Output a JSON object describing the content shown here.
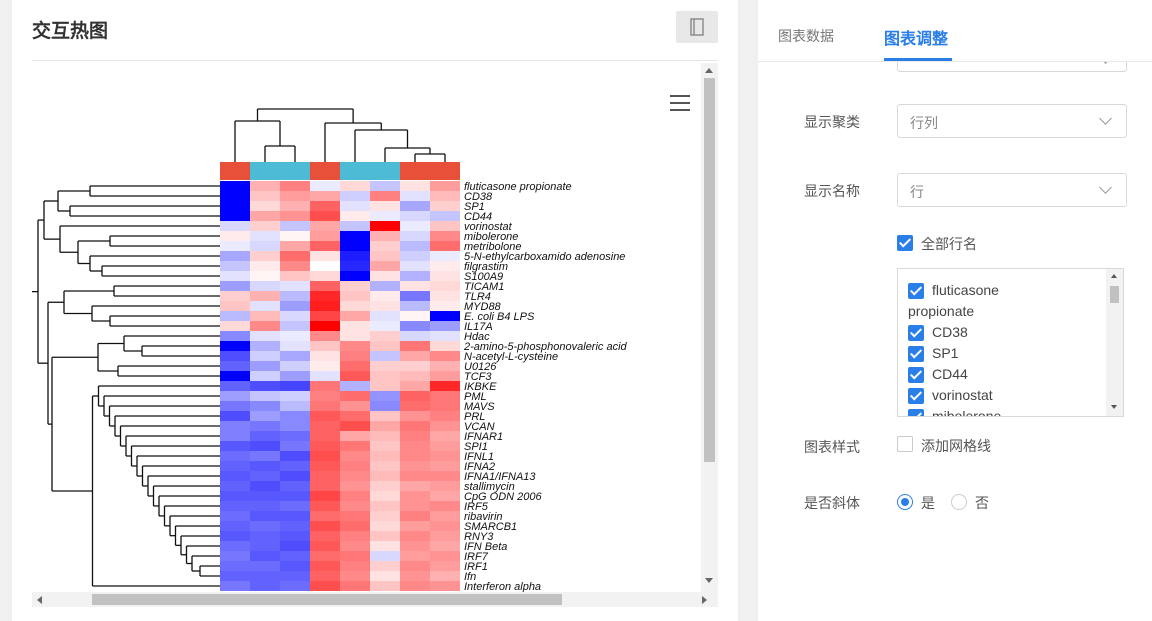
{
  "panel": {
    "title": "交互热图",
    "toolbar_icon": "document-icon",
    "menu_icon": "hamburger-menu-icon"
  },
  "chart_data": {
    "type": "heatmap",
    "columns": 8,
    "column_groups": [
      "red",
      "cyan",
      "cyan",
      "red",
      "cyan",
      "cyan",
      "red",
      "red"
    ],
    "rows": [
      "fluticasone propionate",
      "CD38",
      "SP1",
      "CD44",
      "vorinostat",
      "mibolerone",
      "metribolone",
      "5-N-ethylcarboxamido adenosine",
      "filgrastim",
      "S100A9",
      "TICAM1",
      "TLR4",
      "MYD88",
      "E. coli B4 LPS",
      "IL17A",
      "Hdac",
      "2-amino-5-phosphonovaleric acid",
      "N-acetyl-L-cysteine",
      "U0126",
      "TCF3",
      "IKBKE",
      "PML",
      "MAVS",
      "PRL",
      "VCAN",
      "IFNAR1",
      "SPI1",
      "IFNL1",
      "IFNA2",
      "IFNA1/IFNA13",
      "stallimycin",
      "CpG ODN 2006",
      "IRF5",
      "ribavirin",
      "SMARCB1",
      "RNY3",
      "IFN Beta",
      "IRF7",
      "IRF1",
      "Ifn",
      "Interferon alpha"
    ],
    "values": [
      [
        -2.6,
        0.8,
        1.3,
        -0.2,
        0.4,
        -0.6,
        0.3,
        1.0
      ],
      [
        -2.6,
        0.6,
        1.0,
        0.9,
        -0.5,
        1.3,
        -0.3,
        0.7
      ],
      [
        -2.6,
        0.4,
        0.8,
        1.6,
        -0.3,
        0.3,
        -0.9,
        0.5
      ],
      [
        -2.6,
        0.9,
        1.1,
        1.8,
        0.2,
        -0.2,
        -0.4,
        -0.6
      ],
      [
        -0.4,
        0.5,
        -0.6,
        0.9,
        -0.6,
        2.6,
        -0.2,
        0.6
      ],
      [
        0.2,
        -0.3,
        0.1,
        1.0,
        -2.6,
        0.8,
        -0.4,
        1.2
      ],
      [
        -0.2,
        -0.4,
        0.9,
        1.6,
        -2.6,
        0.5,
        -0.7,
        1.5
      ],
      [
        -0.9,
        0.5,
        1.5,
        0.3,
        -2.3,
        0.6,
        -0.5,
        -0.2
      ],
      [
        -0.6,
        0.2,
        1.2,
        0.0,
        -2.2,
        0.9,
        -0.3,
        0.2
      ],
      [
        -0.3,
        0.1,
        0.6,
        0.4,
        -2.6,
        0.3,
        -0.8,
        0.3
      ],
      [
        -1.0,
        -0.4,
        -0.3,
        1.6,
        0.5,
        -0.8,
        0.3,
        0.4
      ],
      [
        0.5,
        0.8,
        -0.7,
        2.2,
        0.6,
        0.2,
        -1.4,
        0.3
      ],
      [
        0.6,
        -0.3,
        -1.0,
        2.3,
        0.4,
        0.3,
        -0.7,
        0.2
      ],
      [
        -0.7,
        0.7,
        -0.4,
        1.9,
        0.9,
        -0.3,
        0.1,
        -2.6
      ],
      [
        0.4,
        1.2,
        -0.6,
        2.6,
        0.3,
        -0.2,
        -1.2,
        -1.0
      ],
      [
        -1.2,
        -0.3,
        -0.2,
        1.2,
        0.3,
        0.5,
        -0.4,
        -0.3
      ],
      [
        -2.6,
        -0.8,
        -0.3,
        0.6,
        1.2,
        0.6,
        1.4,
        0.4
      ],
      [
        -1.8,
        -0.5,
        -0.9,
        0.3,
        1.3,
        -0.6,
        0.9,
        1.2
      ],
      [
        -1.6,
        -1.0,
        -0.5,
        0.2,
        1.5,
        0.5,
        0.5,
        0.8
      ],
      [
        -2.6,
        -0.5,
        -1.0,
        -0.3,
        1.7,
        0.6,
        0.7,
        1.0
      ],
      [
        -1.6,
        -1.8,
        -1.9,
        1.4,
        -0.8,
        0.6,
        0.9,
        2.2
      ],
      [
        -1.0,
        -0.6,
        -0.5,
        1.3,
        1.5,
        -1.1,
        1.6,
        1.4
      ],
      [
        -1.4,
        -1.2,
        -0.7,
        1.4,
        1.1,
        -1.2,
        1.5,
        1.4
      ],
      [
        -1.8,
        -1.0,
        -1.2,
        1.7,
        1.5,
        0.6,
        1.1,
        1.3
      ],
      [
        -1.3,
        -1.4,
        -1.2,
        1.6,
        1.8,
        0.9,
        1.4,
        1.1
      ],
      [
        -1.3,
        -1.6,
        -1.5,
        1.6,
        0.9,
        0.7,
        1.3,
        0.9
      ],
      [
        -1.7,
        -1.8,
        -1.4,
        1.7,
        1.4,
        0.6,
        1.2,
        1.0
      ],
      [
        -1.5,
        -1.4,
        -1.8,
        1.8,
        1.2,
        0.7,
        1.2,
        1.1
      ],
      [
        -1.6,
        -1.7,
        -1.6,
        1.7,
        1.3,
        0.6,
        1.1,
        1.0
      ],
      [
        -1.7,
        -1.6,
        -1.8,
        1.6,
        1.2,
        0.7,
        1.2,
        1.2
      ],
      [
        -1.6,
        -1.8,
        -1.6,
        1.6,
        1.1,
        0.5,
        0.9,
        1.0
      ],
      [
        -1.7,
        -1.7,
        -1.7,
        1.9,
        1.3,
        0.4,
        1.1,
        0.9
      ],
      [
        -1.6,
        -1.6,
        -1.5,
        1.7,
        1.2,
        0.6,
        1.1,
        1.2
      ],
      [
        -1.5,
        -1.7,
        -1.7,
        1.5,
        1.4,
        0.5,
        1.3,
        1.0
      ],
      [
        -1.6,
        -1.5,
        -1.6,
        1.8,
        1.5,
        0.4,
        1.0,
        1.1
      ],
      [
        -1.7,
        -1.6,
        -1.7,
        1.6,
        1.3,
        0.6,
        1.2,
        1.0
      ],
      [
        -1.5,
        -1.6,
        -1.8,
        1.7,
        1.2,
        0.3,
        1.1,
        0.9
      ],
      [
        -1.4,
        -1.7,
        -1.6,
        1.5,
        1.4,
        -0.4,
        1.0,
        1.1
      ],
      [
        -1.5,
        -1.5,
        -1.7,
        1.7,
        1.3,
        0.5,
        1.2,
        1.0
      ],
      [
        -1.6,
        -1.6,
        -1.6,
        1.6,
        1.2,
        0.3,
        1.1,
        0.8
      ],
      [
        -1.4,
        -1.6,
        -1.5,
        1.8,
        1.4,
        0.6,
        1.2,
        1.1
      ]
    ]
  },
  "tabs": [
    {
      "label": "图表数据",
      "active": false
    },
    {
      "label": "图表调整",
      "active": true
    }
  ],
  "settings": {
    "cluster_label": "显示聚类",
    "cluster_value": "行列",
    "name_label": "显示名称",
    "name_value": "行",
    "all_rows_label": "全部行名",
    "row_list": [
      "fluticasone",
      "propionate",
      "CD38",
      "SP1",
      "CD44",
      "vorinostat",
      "mibolerone"
    ],
    "style_label": "图表样式",
    "grid_label": "添加网格线",
    "italic_label": "是否斜体",
    "yes_label": "是",
    "no_label": "否"
  },
  "colors": {
    "accent": "#2a7ee8",
    "group_red": "#e8503a",
    "group_cyan": "#4dbbd5",
    "low": "#0000ff",
    "high": "#ff0000"
  }
}
